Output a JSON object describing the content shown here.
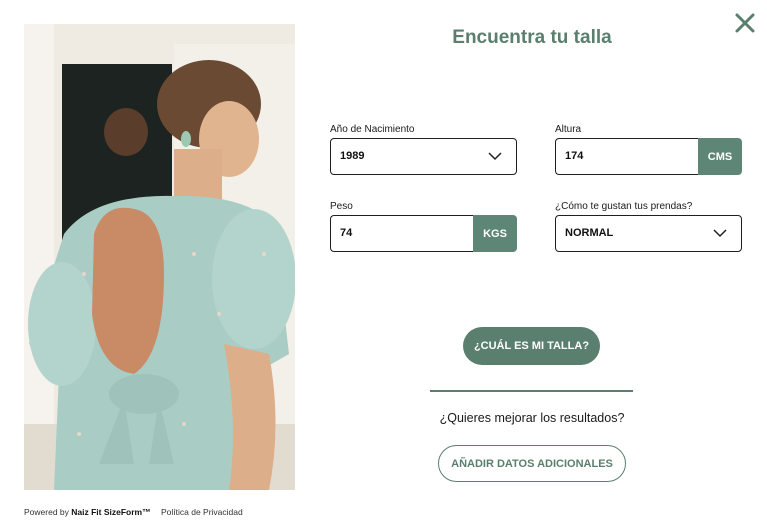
{
  "dialog": {
    "title": "Encuentra tu talla",
    "close_icon": "close-icon"
  },
  "photo": {
    "alt": "model-photo"
  },
  "form": {
    "birth_year": {
      "label": "Año de Nacimiento",
      "value": "1989"
    },
    "height": {
      "label": "Altura",
      "value": "174",
      "unit": "CMS"
    },
    "weight": {
      "label": "Peso",
      "value": "74",
      "unit": "KGS"
    },
    "fit": {
      "label": "¿Cómo te gustan tus prendas?",
      "value": "NORMAL"
    }
  },
  "actions": {
    "submit_label": "¿CUÁL ES MI TALLA?",
    "improve_text": "¿Quieres mejorar los resultados?",
    "additional_label": "AÑADIR DATOS ADICIONALES"
  },
  "footer": {
    "powered_prefix": "Powered by",
    "brand": "Naiz Fit SizeForm™",
    "privacy": "Política de Privacidad"
  },
  "colors": {
    "accent": "#5b7f6e",
    "unit_bg": "#5e8676"
  }
}
